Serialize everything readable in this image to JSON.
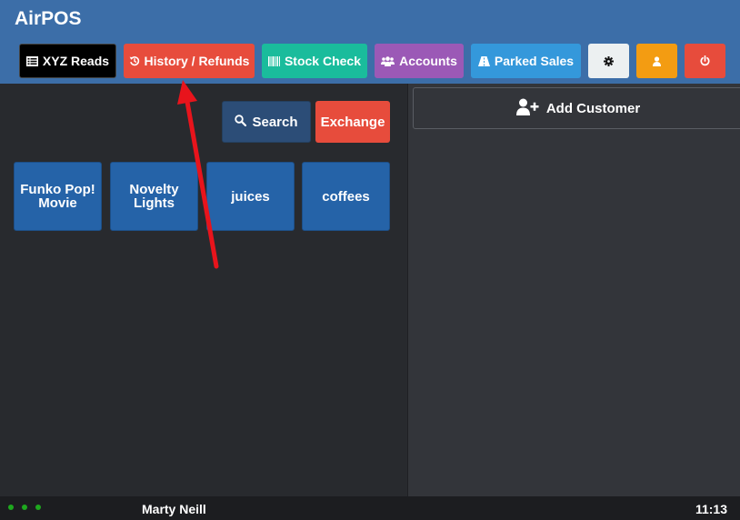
{
  "app": {
    "title": "AirPOS"
  },
  "toolbar": {
    "xyz_reads": "XYZ Reads",
    "history_refunds": "History / Refunds",
    "stock_check": "Stock Check",
    "accounts": "Accounts",
    "parked_sales": "Parked Sales"
  },
  "actions": {
    "search": "Search",
    "exchange": "Exchange"
  },
  "categories": [
    {
      "label": "Funko Pop! Movie"
    },
    {
      "label": "Novelty Lights"
    },
    {
      "label": "juices"
    },
    {
      "label": "coffees"
    }
  ],
  "customer": {
    "add_label": "Add Customer"
  },
  "footer": {
    "user": "Marty Neill",
    "time": "11:13"
  },
  "colors": {
    "header": "#3c6ea8",
    "xyz_reads": "#000000",
    "history_refunds": "#e74c3c",
    "stock_check": "#1abc9c",
    "accounts": "#9b59b6",
    "parked_sales": "#3498db",
    "settings": "#ecf0f1",
    "user": "#f39c12",
    "power": "#e74c3c",
    "category": "#2563a8",
    "search": "#2c4d77",
    "exchange": "#e74c3c",
    "status_online": "#1ea81e",
    "annotation_arrow": "#e8141c"
  },
  "icons": {
    "xyz_reads": "list-icon",
    "history_refunds": "history-icon",
    "stock_check": "barcode-icon",
    "accounts": "users-icon",
    "parked_sales": "road-icon",
    "settings": "gear-icon",
    "user": "user-icon",
    "power": "power-icon",
    "search": "search-icon",
    "add_customer": "user-plus-icon"
  }
}
